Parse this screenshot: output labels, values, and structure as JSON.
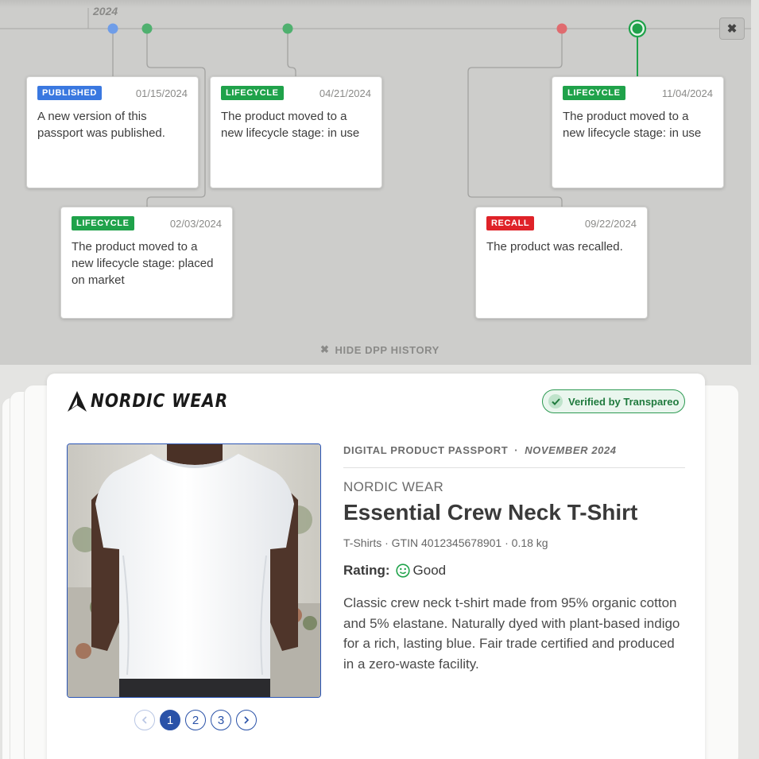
{
  "timeline": {
    "year": "2024",
    "hide_label": "HIDE DPP HISTORY",
    "close_label": "✖",
    "events": [
      {
        "badge": "PUBLISHED",
        "badge_color": "#3a78e0",
        "date": "01/15/2024",
        "text": "A new version of this passport was published."
      },
      {
        "badge": "LIFECYCLE",
        "badge_color": "#1fa24a",
        "date": "04/21/2024",
        "text": "The product moved to a new lifecycle stage: in use"
      },
      {
        "badge": "LIFECYCLE",
        "badge_color": "#1fa24a",
        "date": "11/04/2024",
        "text": "The product moved to a new lifecycle stage: in use"
      },
      {
        "badge": "LIFECYCLE",
        "badge_color": "#1fa24a",
        "date": "02/03/2024",
        "text": "The product moved to a new lifecycle stage: placed on market"
      },
      {
        "badge": "RECALL",
        "badge_color": "#df2228",
        "date": "09/22/2024",
        "text": "The product was recalled."
      }
    ]
  },
  "passport": {
    "brand": "NORDIC WEAR",
    "verified": "Verified by Transpareo",
    "label": "DIGITAL PRODUCT PASSPORT",
    "separator": "·",
    "date": "NOVEMBER 2024",
    "brand_name": "NORDIC WEAR",
    "title": "Essential Crew Neck T-Shirt",
    "meta": "T-Shirts · GTIN 4012345678901 · 0.18 kg",
    "rating_label": "Rating:",
    "rating_value": "Good",
    "description": "Classic crew neck t-shirt made from 95% organic cotton and 5% elastane. Naturally dyed with plant-based indigo for a rich, lasting blue. Fair trade certified and produced in a zero-waste facility.",
    "pages": [
      "1",
      "2",
      "3"
    ],
    "current_page": 1
  },
  "colors": {
    "accent": "#2a52a8",
    "verified_green": "#1f7a3d",
    "lifecycle_green": "#1fa24a",
    "recall_red": "#df2228",
    "published_blue": "#3a78e0"
  },
  "icons": {
    "close": "close-icon",
    "check": "check-icon",
    "brand": "brand-logo-icon",
    "rating": "smiley-icon",
    "prev": "chevron-left-icon",
    "next": "chevron-right-icon"
  }
}
